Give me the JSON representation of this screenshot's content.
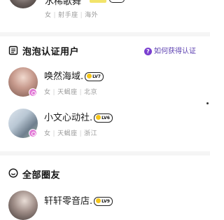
{
  "top_user": {
    "name": "水稀歌舞",
    "gender": "女",
    "zodiac": "射手座",
    "region": "海外"
  },
  "verified_section": {
    "title": "泡泡认证用户",
    "link_label": "如何获得认证",
    "link_icon": "question-icon"
  },
  "verified_users": [
    {
      "name": "唤然海域.",
      "level": "LV7",
      "gender": "女",
      "zodiac": "天蝎座",
      "region": "北京"
    },
    {
      "name": "小文心动社.",
      "level": "LV6",
      "gender": "女",
      "zodiac": "天蝎座",
      "region": "浙江"
    }
  ],
  "global_section": {
    "title": "全部圈友"
  },
  "global_users": [
    {
      "name": "轩轩零音店.",
      "level": "LV9"
    }
  ],
  "colors": {
    "accent": "#7a3fd0",
    "badge": "#e27ad6",
    "level_dot": "#f5c518"
  }
}
